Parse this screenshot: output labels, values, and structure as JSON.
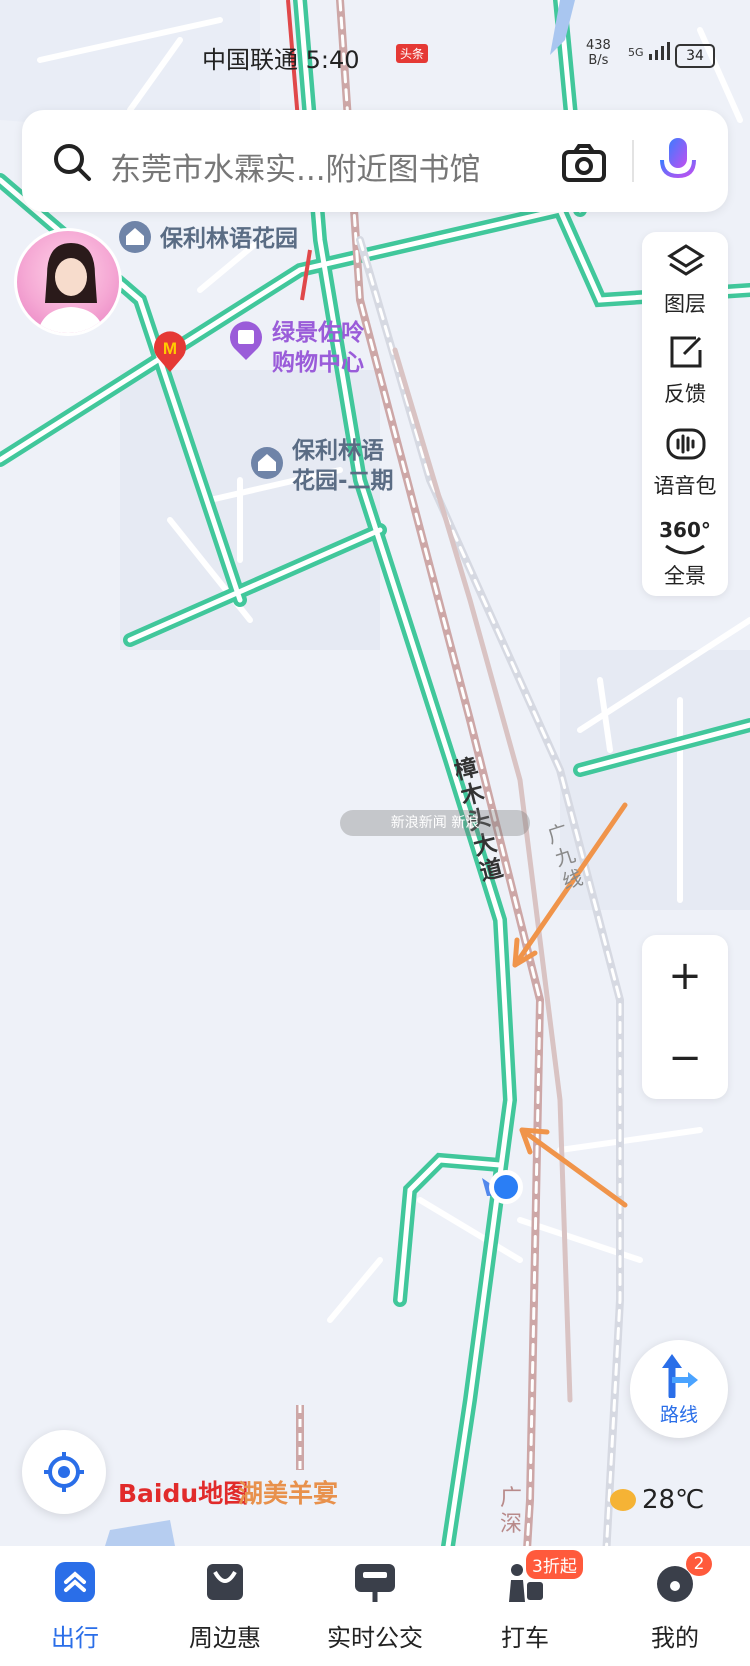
{
  "status_bar": {
    "carrier_time": "中国联通 5:40",
    "toutiao_badge": "头条",
    "net_speed": "438\nB/s",
    "signal": "5G",
    "battery": "34"
  },
  "search": {
    "placeholder": "东莞市水霖实...附近图书馆",
    "icons": [
      "search-icon",
      "camera-icon",
      "microphone-icon"
    ]
  },
  "map": {
    "pois": [
      {
        "name": "保利林语花园",
        "kind": "residential"
      },
      {
        "name": "绿景佐呤\n购物中心",
        "kind": "shopping"
      },
      {
        "name": "保利林语\n花园-二期",
        "kind": "residential"
      }
    ],
    "road_label": "樟木头大道",
    "rail_labels": [
      "广九线",
      "广深"
    ],
    "restaurant_label": "湖美羊宴",
    "watermark": "新浪新闻 新浪"
  },
  "tools": [
    {
      "label": "图层",
      "icon": "layers-icon"
    },
    {
      "label": "反馈",
      "icon": "feedback-icon"
    },
    {
      "label": "语音包",
      "icon": "voice-pack-icon"
    },
    {
      "label": "全景",
      "icon": "panorama-360-icon",
      "badge": "360°"
    }
  ],
  "zoom": {
    "in": "+",
    "out": "−"
  },
  "route_button": {
    "label": "路线"
  },
  "weather": {
    "temperature": "28℃",
    "icon": "sunny-cloud-icon"
  },
  "logo": {
    "text": "Baidu地图"
  },
  "colors": {
    "road": "#41c79b",
    "rail": "#c9a8a8",
    "accent": "#2a6ee8",
    "arrow": "#f0944a"
  },
  "bottom_nav": [
    {
      "label": "出行",
      "active": true
    },
    {
      "label": "周边惠",
      "active": false
    },
    {
      "label": "实时公交",
      "active": false
    },
    {
      "label": "打车",
      "active": false,
      "tag": "3折起"
    },
    {
      "label": "我的",
      "active": false,
      "badge": "2"
    }
  ]
}
